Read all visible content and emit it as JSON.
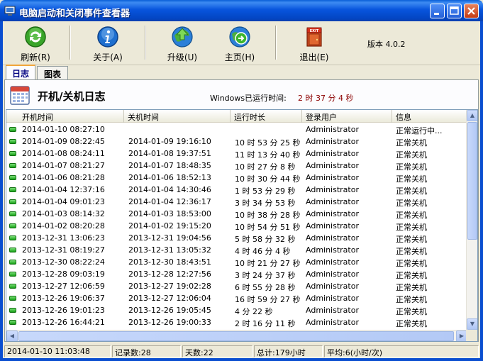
{
  "window": {
    "title": "电脑启动和关闭事件查看器",
    "controls": [
      "minimize",
      "maximize",
      "close"
    ]
  },
  "toolbar": {
    "refresh_label": "刷新(R)",
    "about_label": "关于(A)",
    "upgrade_label": "升级(U)",
    "home_label": "主页(H)",
    "exit_label": "退出(E)",
    "exit_icon_text": "EXIT",
    "version": "版本 4.0.2"
  },
  "tabs": [
    "日志",
    "图表"
  ],
  "log": {
    "title": "开机/关机日志",
    "run_label": "Windows已运行时间:",
    "run_value": "2 时 37 分 4 秒"
  },
  "table": {
    "columns": [
      "开机时间",
      "关机时间",
      "运行时长",
      "登录用户",
      "信息"
    ],
    "rows": [
      [
        "2014-01-10 08:27:10",
        "",
        "",
        "Administrator",
        "正常运行中..."
      ],
      [
        "2014-01-09 08:22:45",
        "2014-01-09 19:16:10",
        "10 时 53 分 25 秒",
        "Administrator",
        "正常关机"
      ],
      [
        "2014-01-08 08:24:11",
        "2014-01-08 19:37:51",
        "11 时 13 分 40 秒",
        "Administrator",
        "正常关机"
      ],
      [
        "2014-01-07 08:21:27",
        "2014-01-07 18:48:35",
        "10 时 27 分 8 秒",
        "Administrator",
        "正常关机"
      ],
      [
        "2014-01-06 08:21:28",
        "2014-01-06 18:52:13",
        "10 时 30 分 44 秒",
        "Administrator",
        "正常关机"
      ],
      [
        "2014-01-04 12:37:16",
        "2014-01-04 14:30:46",
        "1 时 53 分 29 秒",
        "Administrator",
        "正常关机"
      ],
      [
        "2014-01-04 09:01:23",
        "2014-01-04 12:36:17",
        "3 时 34 分 53 秒",
        "Administrator",
        "正常关机"
      ],
      [
        "2014-01-03 08:14:32",
        "2014-01-03 18:53:00",
        "10 时 38 分 28 秒",
        "Administrator",
        "正常关机"
      ],
      [
        "2014-01-02 08:20:28",
        "2014-01-02 19:15:20",
        "10 时 54 分 51 秒",
        "Administrator",
        "正常关机"
      ],
      [
        "2013-12-31 13:06:23",
        "2013-12-31 19:04:56",
        "5 时 58 分 32 秒",
        "Administrator",
        "正常关机"
      ],
      [
        "2013-12-31 08:19:27",
        "2013-12-31 13:05:32",
        "4 时 46 分 4 秒",
        "Administrator",
        "正常关机"
      ],
      [
        "2013-12-30 08:22:24",
        "2013-12-30 18:43:51",
        "10 时 21 分 27 秒",
        "Administrator",
        "正常关机"
      ],
      [
        "2013-12-28 09:03:19",
        "2013-12-28 12:27:56",
        "3 时 24 分 37 秒",
        "Administrator",
        "正常关机"
      ],
      [
        "2013-12-27 12:06:59",
        "2013-12-27 19:02:28",
        "6 时 55 分 28 秒",
        "Administrator",
        "正常关机"
      ],
      [
        "2013-12-26 19:06:37",
        "2013-12-27 12:06:04",
        "16 时 59 分 27 秒",
        "Administrator",
        "正常关机"
      ],
      [
        "2013-12-26 19:01:23",
        "2013-12-26 19:05:45",
        "4 分 22 秒",
        "Administrator",
        "正常关机"
      ],
      [
        "2013-12-26 16:44:21",
        "2013-12-26 19:00:33",
        "2 时 16 分 11 秒",
        "Administrator",
        "正常关机"
      ]
    ]
  },
  "statusbar": {
    "date": "2014-01-10 11:03:48",
    "records": "记录数:28",
    "days": "天数:22",
    "total": "总计:179小时",
    "average": "平均:6(小时/次)"
  },
  "colors": {
    "titlebar": "#0855dd",
    "runtime_value": "#8b0000",
    "status_led": "#17a017"
  },
  "icons": [
    "app-icon",
    "refresh-icon",
    "about-icon",
    "upgrade-icon",
    "home-icon",
    "exit-icon",
    "calendar-icon",
    "status-led-icon"
  ]
}
